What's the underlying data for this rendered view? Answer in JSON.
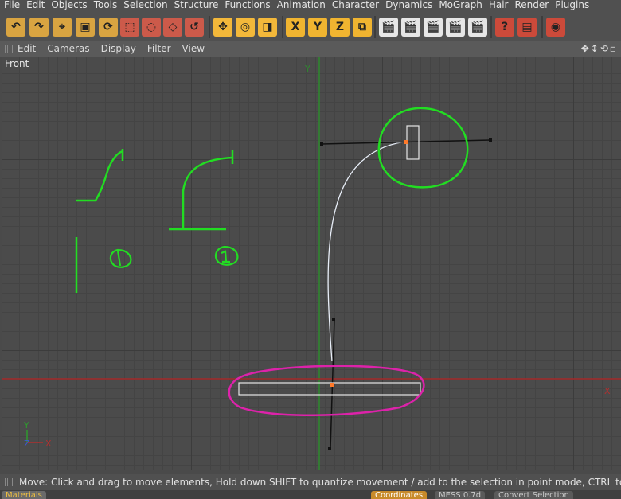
{
  "menubar": {
    "items": [
      "File",
      "Edit",
      "Objects",
      "Tools",
      "Selection",
      "Structure",
      "Functions",
      "Animation",
      "Character",
      "Dynamics",
      "MoGraph",
      "Hair",
      "Render",
      "Plugins"
    ]
  },
  "toolbar": {
    "buttons": [
      {
        "name": "undo-icon",
        "glyph": "↶",
        "bg": "#d9a441"
      },
      {
        "name": "redo-icon",
        "glyph": "↷",
        "bg": "#d9a441"
      },
      {
        "name": "live-selection-icon",
        "glyph": "⌖",
        "bg": "#d9a441"
      },
      {
        "name": "scale-icon",
        "glyph": "▣",
        "bg": "#d9a441"
      },
      {
        "name": "rotate-icon",
        "glyph": "⟳",
        "bg": "#d9a441"
      },
      {
        "name": "rect-select-icon",
        "glyph": "⬚",
        "bg": "#cc5a4a"
      },
      {
        "name": "lasso-select-icon",
        "glyph": "◌",
        "bg": "#cc5a4a"
      },
      {
        "name": "poly-select-icon",
        "glyph": "◇",
        "bg": "#cc5a4a"
      },
      {
        "name": "select-loop-icon",
        "glyph": "↺",
        "bg": "#cc5a4a"
      },
      {
        "name": "move-icon",
        "glyph": "✥",
        "bg": "#f3b83a"
      },
      {
        "name": "rotate-tool-icon",
        "glyph": "◎",
        "bg": "#f3b83a"
      },
      {
        "name": "scale-tool-icon",
        "glyph": "◨",
        "bg": "#f3b83a"
      },
      {
        "name": "x-axis-icon",
        "glyph": "X",
        "bg": "#f0b430"
      },
      {
        "name": "y-axis-icon",
        "glyph": "Y",
        "bg": "#f0b430"
      },
      {
        "name": "z-axis-icon",
        "glyph": "Z",
        "bg": "#f0b430"
      },
      {
        "name": "coordinate-system-icon",
        "glyph": "⧉",
        "bg": "#f0b430"
      },
      {
        "name": "render-view-icon",
        "glyph": "🎬",
        "bg": "#e6e6e6"
      },
      {
        "name": "render-region-icon",
        "glyph": "🎬",
        "bg": "#e6e6e6"
      },
      {
        "name": "render-picture-viewer-icon",
        "glyph": "🎬",
        "bg": "#e6e6e6"
      },
      {
        "name": "render-settings-icon",
        "glyph": "🎬",
        "bg": "#e6e6e6"
      },
      {
        "name": "render-queue-icon",
        "glyph": "🎬",
        "bg": "#e6e6e6"
      },
      {
        "name": "help-icon",
        "glyph": "?",
        "bg": "#cc4a3a"
      },
      {
        "name": "object-manager-icon",
        "glyph": "▤",
        "bg": "#cc4a3a"
      },
      {
        "name": "material-icon",
        "glyph": "◉",
        "bg": "#cc4a3a"
      }
    ]
  },
  "viewmenu": {
    "items": [
      "Edit",
      "Cameras",
      "Display",
      "Filter",
      "View"
    ]
  },
  "viewport": {
    "label": "Front",
    "axis_y_label": "Y",
    "axis_x_label": "X",
    "gizmo_y": "Y",
    "gizmo_x": "X",
    "gizmo_z": "Z"
  },
  "status": {
    "text": "Move: Click and drag to move elements, Hold down SHIFT to quantize movement / add to the selection in point mode, CTRL to remove"
  },
  "bottomtabs": {
    "materials": "Materials",
    "coordinates": "Coordinates",
    "mess": "MESS 0.7d",
    "convert": "Convert Selection"
  },
  "colors": {
    "annotation_green": "#22dd22",
    "annotation_magenta": "#dd22aa",
    "axis_green": "#2d8a2d",
    "axis_red": "#a52a2a",
    "point_orange": "#ff7a2a"
  }
}
